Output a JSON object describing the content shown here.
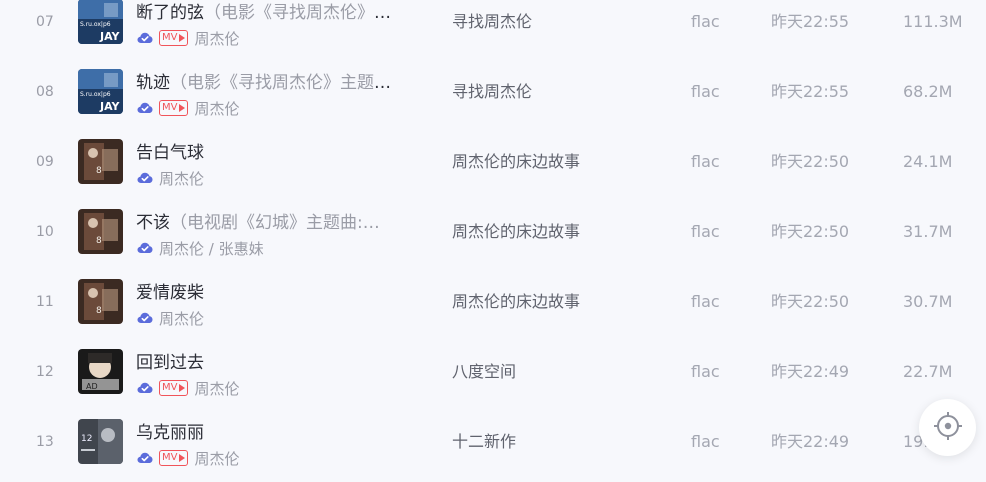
{
  "tracks": [
    {
      "index": "07",
      "title": "断了的弦",
      "subtitle": "（电影《寻找周杰伦》插曲）",
      "has_mv": true,
      "artists": "周杰伦",
      "album": "寻找周杰伦",
      "format": "flac",
      "time": "昨天22:55",
      "size": "111.3M",
      "cover": "jay"
    },
    {
      "index": "08",
      "title": "轨迹",
      "subtitle": "（电影《寻找周杰伦》主题曲）",
      "has_mv": true,
      "artists": "周杰伦",
      "album": "寻找周杰伦",
      "format": "flac",
      "time": "昨天22:55",
      "size": "68.2M",
      "cover": "jay"
    },
    {
      "index": "09",
      "title": "告白气球",
      "subtitle": "",
      "has_mv": false,
      "artists": "周杰伦",
      "album": "周杰伦的床边故事",
      "format": "flac",
      "time": "昨天22:50",
      "size": "24.1M",
      "cover": "bedside"
    },
    {
      "index": "10",
      "title": "不该",
      "subtitle": "（电视剧《幻城》主题曲:…",
      "has_mv": false,
      "artists": "周杰伦 / 张惠妹",
      "album": "周杰伦的床边故事",
      "format": "flac",
      "time": "昨天22:50",
      "size": "31.7M",
      "cover": "bedside"
    },
    {
      "index": "11",
      "title": "爱情废柴",
      "subtitle": "",
      "has_mv": false,
      "artists": "周杰伦",
      "album": "周杰伦的床边故事",
      "format": "flac",
      "time": "昨天22:50",
      "size": "30.7M",
      "cover": "bedside"
    },
    {
      "index": "12",
      "title": "回到过去",
      "subtitle": "",
      "has_mv": true,
      "artists": "周杰伦",
      "album": "八度空间",
      "format": "flac",
      "time": "昨天22:49",
      "size": "22.7M",
      "cover": "octave"
    },
    {
      "index": "13",
      "title": "乌克丽丽",
      "subtitle": "",
      "has_mv": true,
      "artists": "周杰伦",
      "album": "十二新作",
      "format": "flac",
      "time": "昨天22:49",
      "size": "19.5M",
      "cover": "twelve"
    }
  ],
  "mv_label": "MV",
  "colors": {
    "accent": "#5b6cdb",
    "mv": "#f0545a"
  },
  "icons": {
    "cloud": "cloud-check-icon",
    "locate": "locate-crosshair-icon"
  }
}
